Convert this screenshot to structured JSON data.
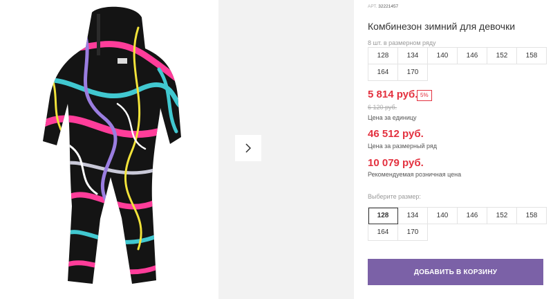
{
  "product": {
    "sku_label": "АРТ.",
    "sku_value": "32221457",
    "title": "Комбинезон зимний для девочки",
    "size_row_note": "8 шт. в размерном ряду",
    "size_row": [
      "128",
      "134",
      "140",
      "146",
      "152",
      "158",
      "164",
      "170"
    ]
  },
  "prices": {
    "unit_price": "5 814 руб.",
    "discount": "5%",
    "old_price": "6 120 руб.",
    "unit_label": "Цена за единицу",
    "row_price": "46 512 руб.",
    "row_label": "Цена за размерный ряд",
    "retail_price": "10 079 руб.",
    "retail_label": "Рекомендуемая розничная цена"
  },
  "size_select": {
    "label": "Выберите размер:",
    "selected": "128",
    "options": [
      "128",
      "134",
      "140",
      "146",
      "152",
      "158",
      "164",
      "170"
    ]
  },
  "actions": {
    "add_to_cart": "ДОБАВИТЬ В КОРЗИНУ"
  },
  "gallery": {
    "image_alt": "girl winter jumpsuit with colorful graffiti print",
    "next_icon": "chevron-right-icon"
  },
  "colors": {
    "price_red": "#e3313f",
    "button_purple": "#7b61a7",
    "jumpsuit_base": "#141414",
    "print_pink": "#ff3d9a",
    "print_cyan": "#41c8d0",
    "print_yellow": "#f2e33a"
  }
}
